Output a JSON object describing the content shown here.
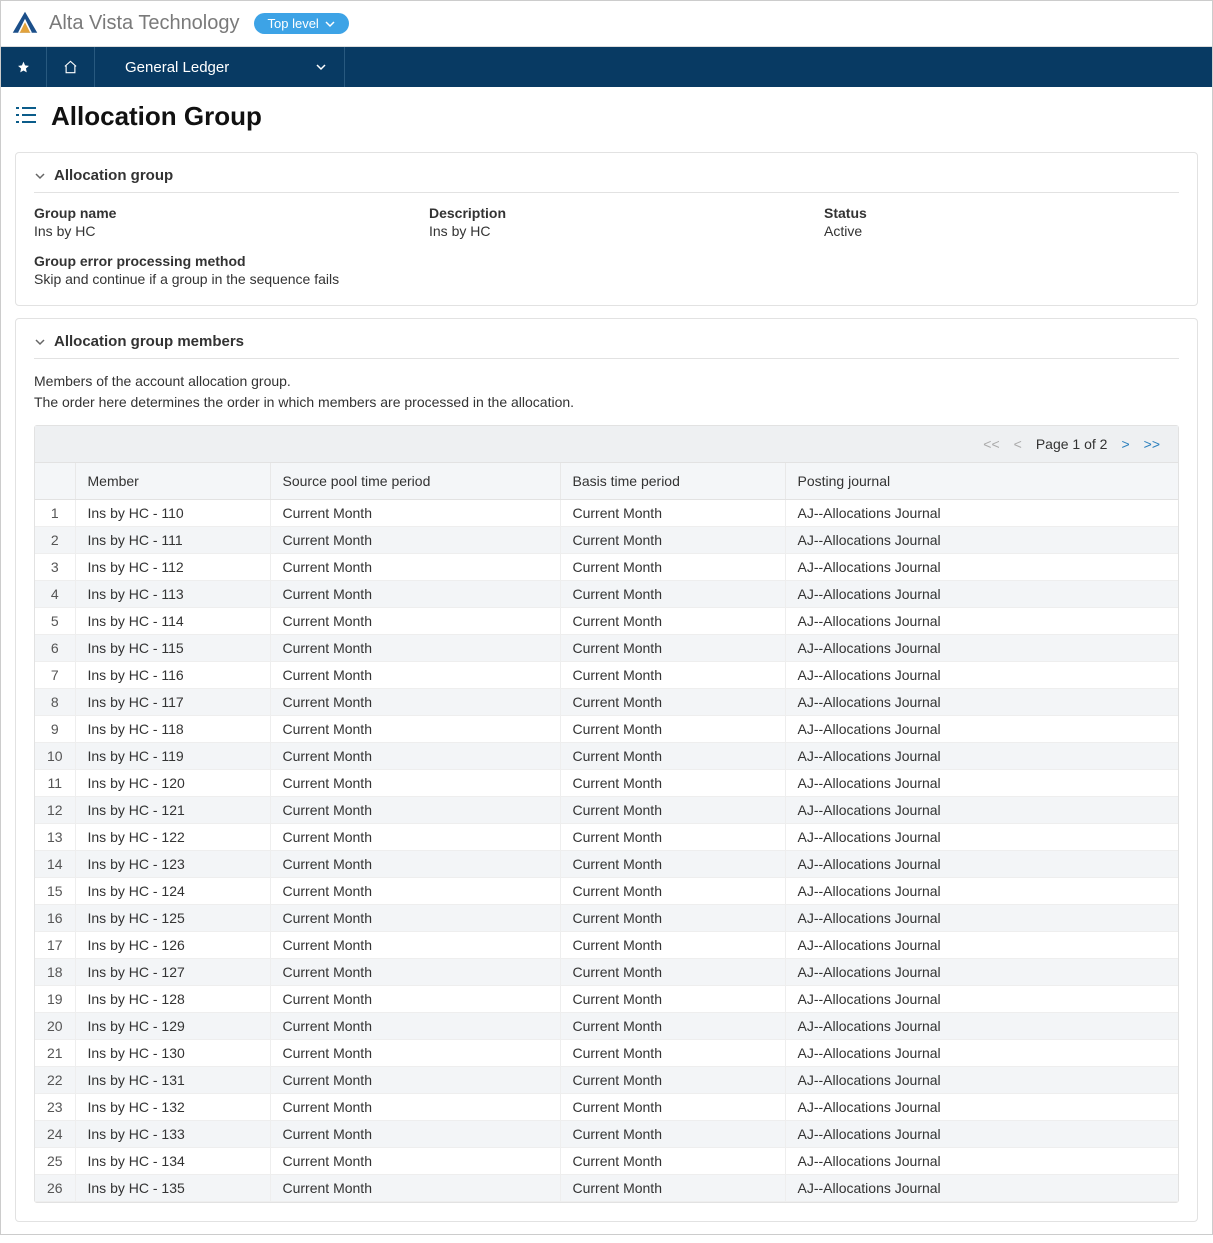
{
  "header": {
    "company": "Alta Vista Technology",
    "pill_label": "Top level"
  },
  "nav": {
    "module": "General Ledger"
  },
  "page": {
    "title": "Allocation Group"
  },
  "panel1": {
    "title": "Allocation group",
    "group_name_label": "Group name",
    "group_name_value": "Ins by HC",
    "description_label": "Description",
    "description_value": "Ins by HC",
    "status_label": "Status",
    "status_value": "Active",
    "error_method_label": "Group error processing method",
    "error_method_value": "Skip and continue if a group in the sequence fails"
  },
  "panel2": {
    "title": "Allocation group members",
    "help1": "Members of the account allocation group.",
    "help2": "The order here determines the order in which members are processed in the allocation.",
    "pager": {
      "first": "<<",
      "prev": "<",
      "label": "Page 1 of 2",
      "next": ">",
      "last": ">>"
    },
    "columns": {
      "num": "",
      "member": "Member",
      "source": "Source pool time period",
      "basis": "Basis time period",
      "journal": "Posting journal"
    },
    "rows": [
      {
        "n": "1",
        "member": "Ins by HC - 110",
        "source": "Current Month",
        "basis": "Current Month",
        "journal": "AJ--Allocations Journal"
      },
      {
        "n": "2",
        "member": "Ins by HC - 111",
        "source": "Current Month",
        "basis": "Current Month",
        "journal": "AJ--Allocations Journal"
      },
      {
        "n": "3",
        "member": "Ins by HC - 112",
        "source": "Current Month",
        "basis": "Current Month",
        "journal": "AJ--Allocations Journal"
      },
      {
        "n": "4",
        "member": "Ins by HC - 113",
        "source": "Current Month",
        "basis": "Current Month",
        "journal": "AJ--Allocations Journal"
      },
      {
        "n": "5",
        "member": "Ins by HC - 114",
        "source": "Current Month",
        "basis": "Current Month",
        "journal": "AJ--Allocations Journal"
      },
      {
        "n": "6",
        "member": "Ins by HC - 115",
        "source": "Current Month",
        "basis": "Current Month",
        "journal": "AJ--Allocations Journal"
      },
      {
        "n": "7",
        "member": "Ins by HC - 116",
        "source": "Current Month",
        "basis": "Current Month",
        "journal": "AJ--Allocations Journal"
      },
      {
        "n": "8",
        "member": "Ins by HC - 117",
        "source": "Current Month",
        "basis": "Current Month",
        "journal": "AJ--Allocations Journal"
      },
      {
        "n": "9",
        "member": "Ins by HC - 118",
        "source": "Current Month",
        "basis": "Current Month",
        "journal": "AJ--Allocations Journal"
      },
      {
        "n": "10",
        "member": "Ins by HC - 119",
        "source": "Current Month",
        "basis": "Current Month",
        "journal": "AJ--Allocations Journal"
      },
      {
        "n": "11",
        "member": "Ins by HC - 120",
        "source": "Current Month",
        "basis": "Current Month",
        "journal": "AJ--Allocations Journal"
      },
      {
        "n": "12",
        "member": "Ins by HC - 121",
        "source": "Current Month",
        "basis": "Current Month",
        "journal": "AJ--Allocations Journal"
      },
      {
        "n": "13",
        "member": "Ins by HC - 122",
        "source": "Current Month",
        "basis": "Current Month",
        "journal": "AJ--Allocations Journal"
      },
      {
        "n": "14",
        "member": "Ins by HC - 123",
        "source": "Current Month",
        "basis": "Current Month",
        "journal": "AJ--Allocations Journal"
      },
      {
        "n": "15",
        "member": "Ins by HC - 124",
        "source": "Current Month",
        "basis": "Current Month",
        "journal": "AJ--Allocations Journal"
      },
      {
        "n": "16",
        "member": "Ins by HC - 125",
        "source": "Current Month",
        "basis": "Current Month",
        "journal": "AJ--Allocations Journal"
      },
      {
        "n": "17",
        "member": "Ins by HC - 126",
        "source": "Current Month",
        "basis": "Current Month",
        "journal": "AJ--Allocations Journal"
      },
      {
        "n": "18",
        "member": "Ins by HC - 127",
        "source": "Current Month",
        "basis": "Current Month",
        "journal": "AJ--Allocations Journal"
      },
      {
        "n": "19",
        "member": "Ins by HC - 128",
        "source": "Current Month",
        "basis": "Current Month",
        "journal": "AJ--Allocations Journal"
      },
      {
        "n": "20",
        "member": "Ins by HC - 129",
        "source": "Current Month",
        "basis": "Current Month",
        "journal": "AJ--Allocations Journal"
      },
      {
        "n": "21",
        "member": "Ins by HC - 130",
        "source": "Current Month",
        "basis": "Current Month",
        "journal": "AJ--Allocations Journal"
      },
      {
        "n": "22",
        "member": "Ins by HC - 131",
        "source": "Current Month",
        "basis": "Current Month",
        "journal": "AJ--Allocations Journal"
      },
      {
        "n": "23",
        "member": "Ins by HC - 132",
        "source": "Current Month",
        "basis": "Current Month",
        "journal": "AJ--Allocations Journal"
      },
      {
        "n": "24",
        "member": "Ins by HC - 133",
        "source": "Current Month",
        "basis": "Current Month",
        "journal": "AJ--Allocations Journal"
      },
      {
        "n": "25",
        "member": "Ins by HC - 134",
        "source": "Current Month",
        "basis": "Current Month",
        "journal": "AJ--Allocations Journal"
      },
      {
        "n": "26",
        "member": "Ins by HC - 135",
        "source": "Current Month",
        "basis": "Current Month",
        "journal": "AJ--Allocations Journal"
      }
    ]
  }
}
